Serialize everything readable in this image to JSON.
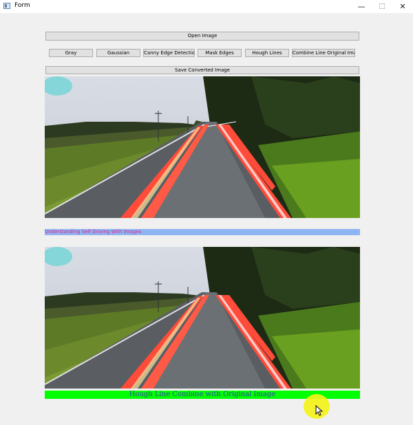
{
  "window": {
    "title": "Form",
    "icon": "app-window-icon",
    "controls": {
      "minimize": "—",
      "maximize": "☐",
      "close": "✕"
    }
  },
  "buttons": {
    "open_image": "Open Image",
    "gray": "Gray",
    "gaussian": "Gaussian",
    "canny": "Canny Edge Detection",
    "mask_edges": "Mask Edges",
    "hough_lines": "Hough Lines",
    "combine": "Combine Line Original Image",
    "save": "Save Converted Image"
  },
  "captions": {
    "top": "Understanding Self Driving With Images",
    "bottom": "Hough Line Combine with Original Image"
  },
  "colors": {
    "caption_top_bg": "#8fb4f3",
    "caption_top_text": "#e0258a",
    "caption_bottom_bg": "#00ff00",
    "caption_bottom_text": "#2f4aa8",
    "lane_lines": "#ff3b30",
    "cursor_highlight": "#f4f31a"
  }
}
